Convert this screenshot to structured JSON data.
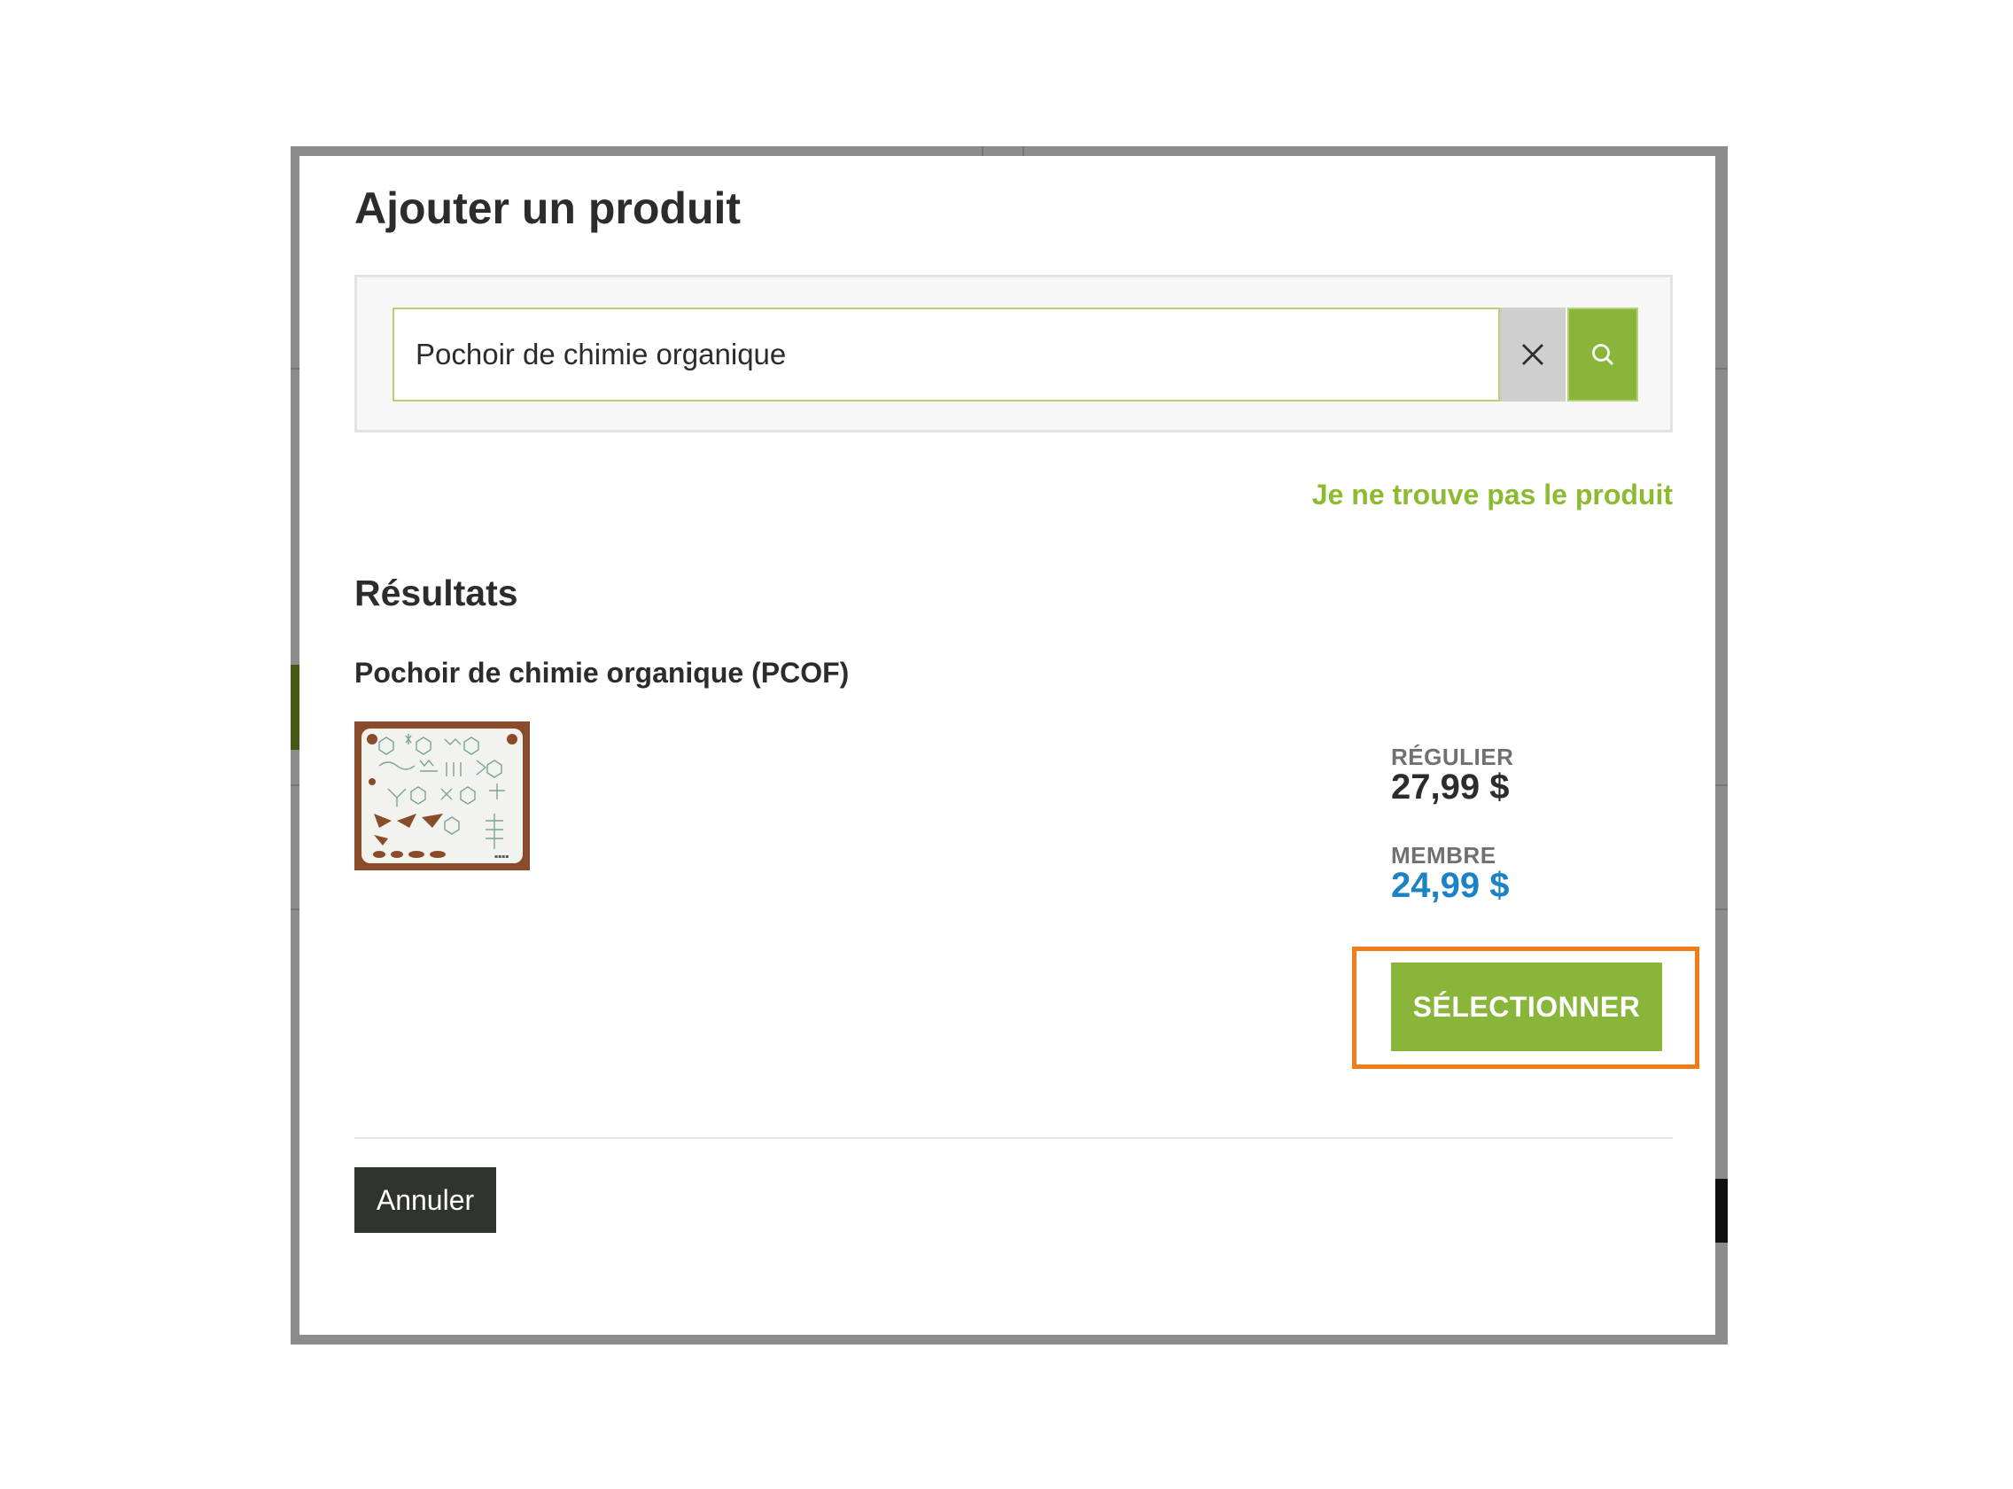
{
  "modal": {
    "title": "Ajouter un produit",
    "search": {
      "value": "Pochoir de chimie organique",
      "clear_icon": "close-icon",
      "search_icon": "search-icon"
    },
    "not_found_link": "Je ne trouve pas le produit",
    "results_heading": "Résultats",
    "product": {
      "name": "Pochoir de chimie organique (PCOF)",
      "regular_label": "RÉGULIER",
      "regular_price": "27,99 $",
      "member_label": "MEMBRE",
      "member_price": "24,99 $",
      "select_label": "SÉLECTIONNER"
    },
    "cancel_label": "Annuler"
  },
  "colors": {
    "accent_green": "#88b53a",
    "link_green": "#8cbb32",
    "member_blue": "#1b82c6",
    "highlight_orange": "#f07d1a",
    "cancel_dark": "#2f342e"
  }
}
